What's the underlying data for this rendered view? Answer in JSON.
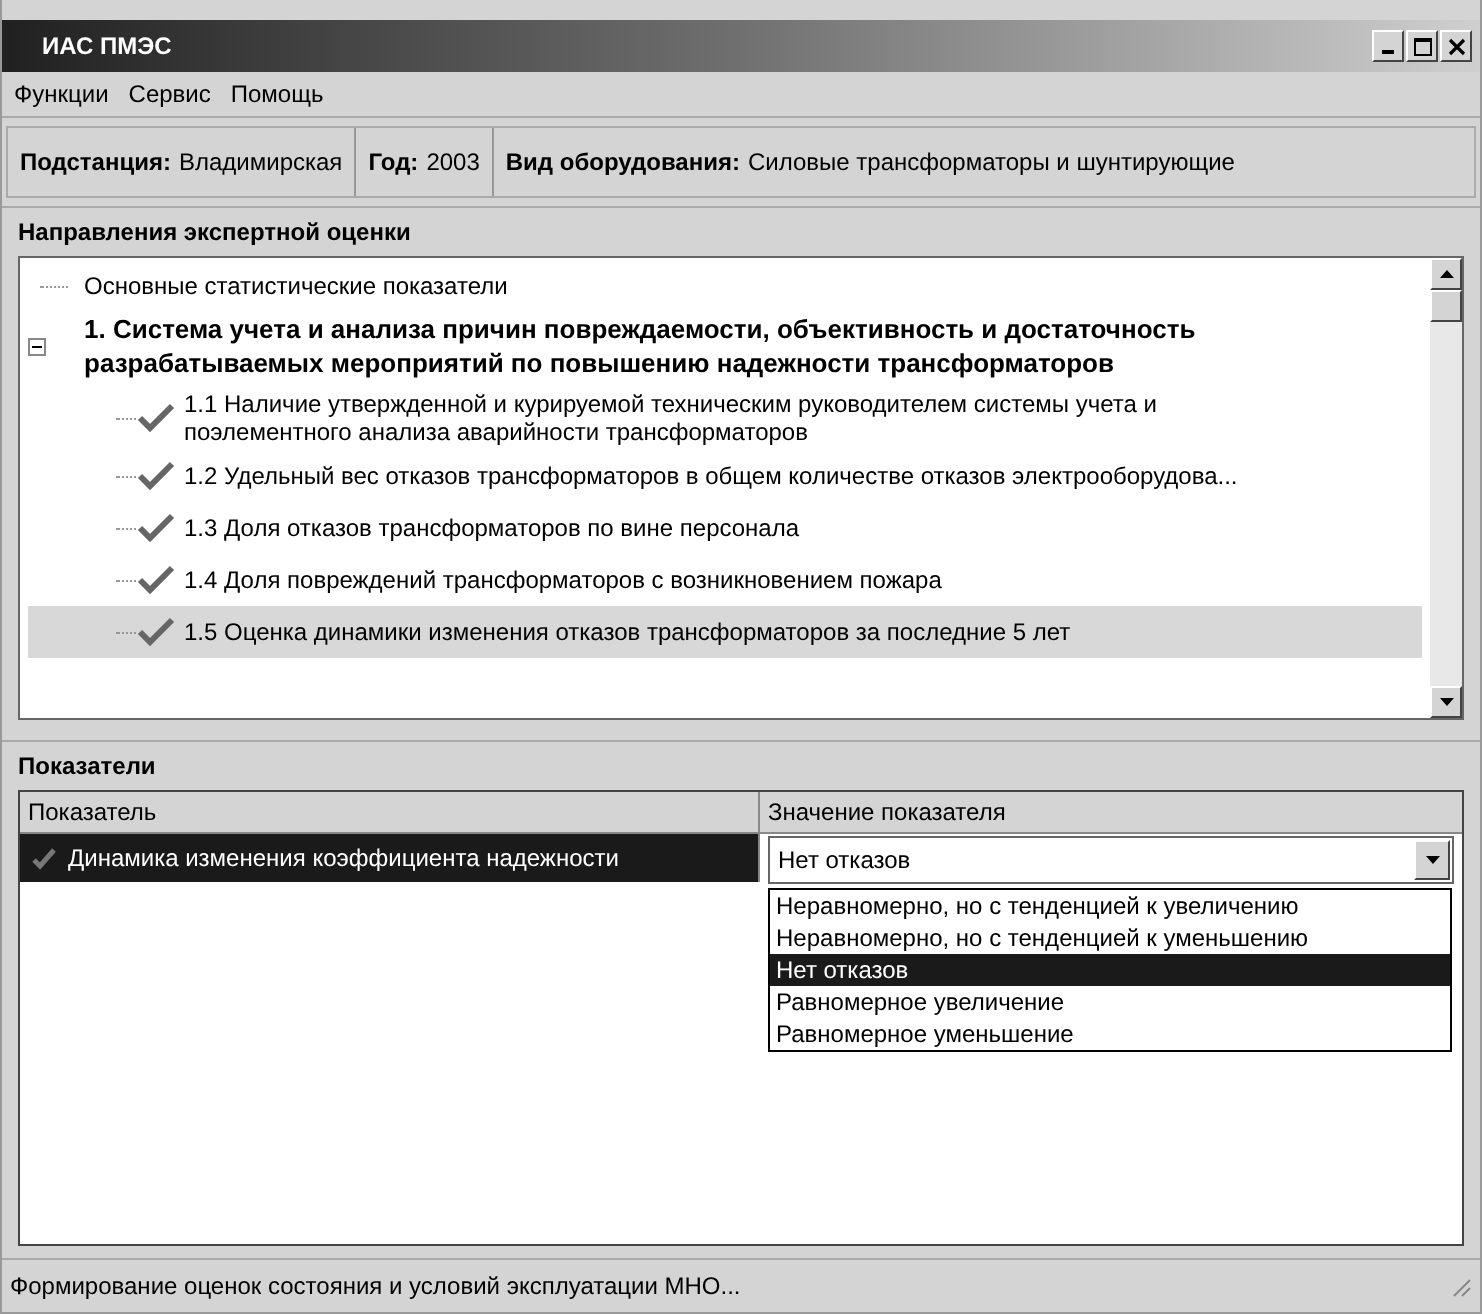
{
  "window": {
    "title": "ИАС ПМЭС"
  },
  "menu": [
    "Функции",
    "Сервис",
    "Помощь"
  ],
  "info_bar": [
    {
      "label": "Подстанция:",
      "value": "Владимирская"
    },
    {
      "label": "Год:",
      "value": "2003"
    },
    {
      "label": "Вид оборудования:",
      "value": "Силовые трансформаторы и шунтирующие"
    }
  ],
  "directions": {
    "title": "Направления экспертной оценки",
    "tree": [
      {
        "label": "Основные статистические показатели",
        "bold": false,
        "selected": false
      },
      {
        "label": "1. Система учета и анализа причин повреждаемости, объективность и достаточность разрабатываемых мероприятий по повышению надежности трансформаторов",
        "bold": true,
        "expanded": true,
        "selected": false,
        "children": [
          {
            "label": "1.1 Наличие утвержденной и курируемой техническим руководителем системы учета и поэлементного анализа аварийности трансформаторов",
            "checked": true,
            "selected": false
          },
          {
            "label": "1.2 Удельный вес отказов трансформаторов в общем количестве отказов электрооборудова...",
            "checked": true,
            "selected": false
          },
          {
            "label": "1.3 Доля отказов трансформаторов по вине персонала",
            "checked": true,
            "selected": false
          },
          {
            "label": "1.4 Доля повреждений трансформаторов с возникновением пожара",
            "checked": true,
            "selected": false
          },
          {
            "label": "1.5 Оценка динамики изменения отказов трансформаторов за последние 5 лет",
            "checked": true,
            "selected": true
          }
        ]
      }
    ]
  },
  "indicators": {
    "title": "Показатели",
    "columns": [
      "Показатель",
      "Значение показателя"
    ],
    "rows": [
      {
        "name": "Динамика изменения коэффициента надежности",
        "selected": true,
        "value": "Нет отказов",
        "options": [
          {
            "label": "Неравномерно, но с тенденцией к увеличению",
            "selected": false
          },
          {
            "label": "Неравномерно, но с тенденцией к уменьшению",
            "selected": false
          },
          {
            "label": "Нет отказов",
            "selected": true
          },
          {
            "label": "Равномерное увеличение",
            "selected": false
          },
          {
            "label": "Равномерное уменьшение",
            "selected": false
          }
        ]
      }
    ]
  },
  "status_bar": "Формирование оценок состояния и условий эксплуатации МНО..."
}
